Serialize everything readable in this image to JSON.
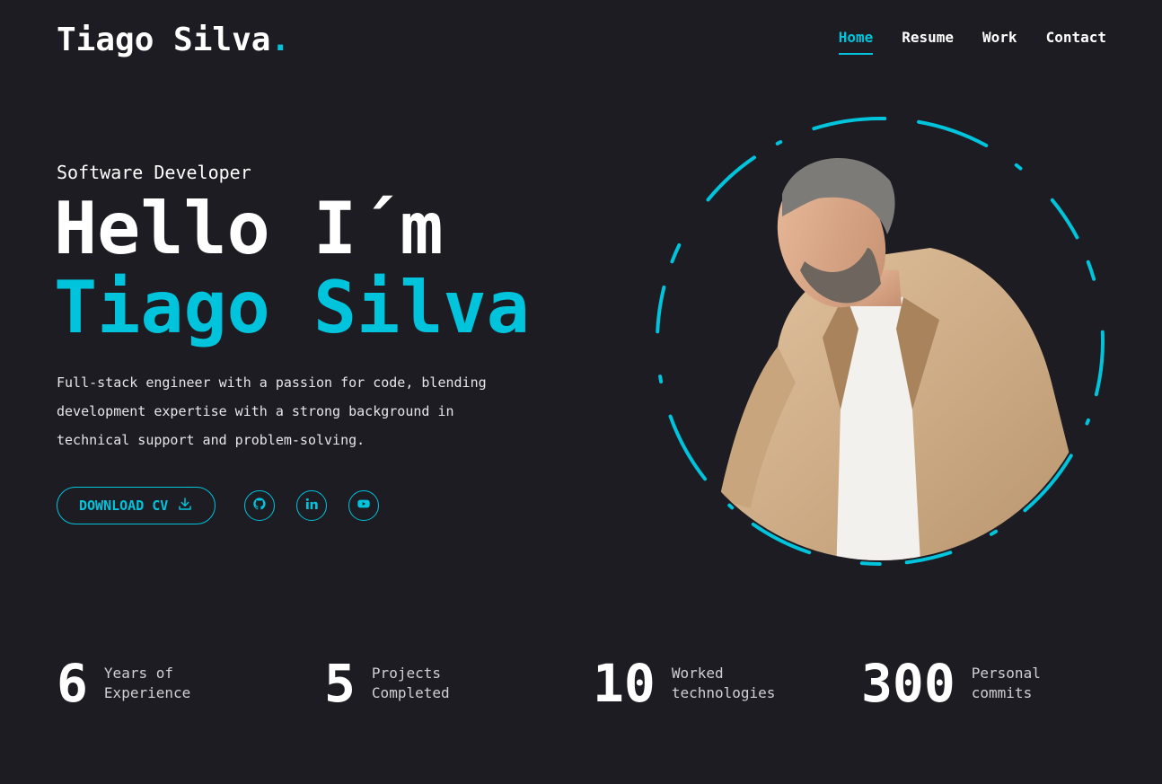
{
  "header": {
    "logo_text": "Tiago Silva",
    "logo_dot": ".",
    "nav": [
      {
        "label": "Home"
      },
      {
        "label": "Resume"
      },
      {
        "label": "Work"
      },
      {
        "label": "Contact"
      }
    ],
    "active_nav": "Home"
  },
  "hero": {
    "role": "Software Developer",
    "greeting": "Hello I´m",
    "name": "Tiago Silva",
    "description": "Full-stack engineer with a passion for code, blending development expertise with a strong background in technical support and problem-solving.",
    "download_label": "DOWNLOAD CV",
    "download_icon": "download-icon",
    "socials": [
      {
        "icon": "github-icon"
      },
      {
        "icon": "linkedin-icon"
      },
      {
        "icon": "youtube-icon"
      }
    ]
  },
  "stats": [
    {
      "value": "6",
      "label": "Years of Experience"
    },
    {
      "value": "5",
      "label": "Projects Completed"
    },
    {
      "value": "10",
      "label": "Worked technologies"
    },
    {
      "value": "300",
      "label": "Personal commits"
    }
  ],
  "colors": {
    "background": "#1d1c22",
    "accent": "#00c3dc",
    "text": "#ffffff"
  }
}
